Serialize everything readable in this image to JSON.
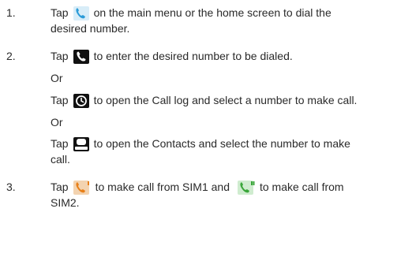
{
  "steps": [
    {
      "number": "1.",
      "lines": [
        {
          "pre": "Tap",
          "icon": "dialer-app-icon",
          "post": "on the main menu or the home screen to dial the"
        },
        {
          "text": "desired number."
        }
      ]
    },
    {
      "number": "2.",
      "lines": [
        {
          "pre": "Tap",
          "icon": "phone-handset-icon",
          "post": "to enter the desired number to be dialed."
        }
      ],
      "or1": "Or",
      "alt1": {
        "pre": "Tap",
        "icon": "clock-icon",
        "post": "to open the Call log and select a number to make call."
      },
      "or2": "Or",
      "alt2": [
        {
          "pre": "Tap",
          "icon": "contact-person-icon",
          "post": "to open the Contacts and select the number to make"
        },
        {
          "text": "call."
        }
      ]
    },
    {
      "number": "3.",
      "lines": [
        {
          "pre": "Tap",
          "icon": "sim1-call-icon",
          "mid": "to make call from SIM1 and",
          "icon2": "sim2-call-icon",
          "post": "to make call from"
        },
        {
          "text": "SIM2."
        }
      ]
    }
  ],
  "colors": {
    "text": "#2a2a2a",
    "sim1_orange": "#e8801a",
    "sim2_green": "#3aa63a",
    "dialer_blue": "#2b9bd8"
  }
}
